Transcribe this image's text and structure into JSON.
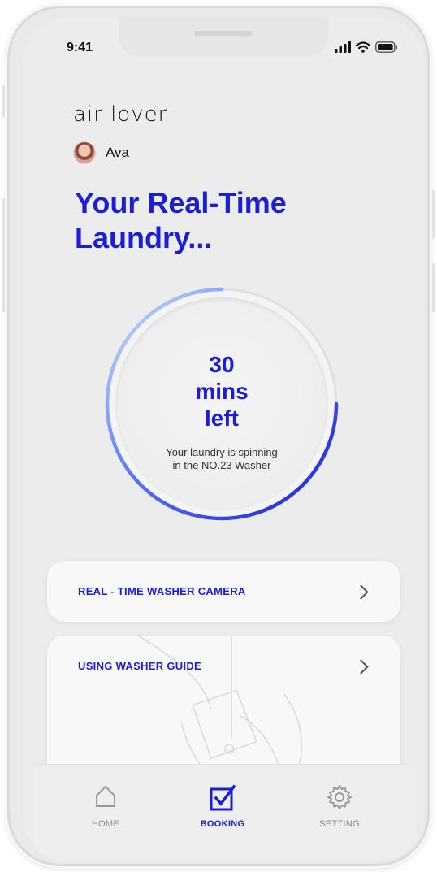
{
  "status_bar": {
    "time": "9:41"
  },
  "brand": {
    "logo_text": "air lover",
    "accent_color": "#1a1ed8"
  },
  "user": {
    "name": "Ava"
  },
  "headline": "Your Real-Time Laundry...",
  "timer": {
    "value": "30",
    "unit_line1": "mins",
    "unit_line2": "left",
    "status_line1": "Your laundry is spinning",
    "status_line2": "in the NO.23 Washer",
    "progress_fraction": 0.75
  },
  "cards": {
    "camera": {
      "label": "REAL - TIME WASHER CAMERA",
      "icon": "chevron-right-icon"
    },
    "guide": {
      "label": "USING WASHER GUIDE",
      "icon": "chevron-right-icon"
    }
  },
  "tabs": [
    {
      "label": "HOME",
      "icon": "home-icon",
      "active": false
    },
    {
      "label": "BOOKING",
      "icon": "checkbox-icon",
      "active": true
    },
    {
      "label": "SETTING",
      "icon": "gear-icon",
      "active": false
    }
  ]
}
